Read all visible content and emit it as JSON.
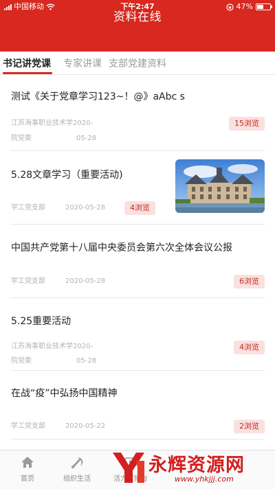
{
  "status_bar": {
    "carrier": "中国移动",
    "time": "下午2:47",
    "battery": "47%"
  },
  "header": {
    "title": "资料在线"
  },
  "tabs": [
    {
      "label": "书记讲党课",
      "active": true
    },
    {
      "label": "专家讲课",
      "active": false
    },
    {
      "label": "支部党建资料",
      "active": false
    }
  ],
  "articles": [
    {
      "title": "测试《关于党章学习123~！@》aAbc s",
      "org_line1": "江苏海事职业技术学2020-",
      "org_line2": "院党委",
      "date_line2": "05-28",
      "views": "15浏览"
    },
    {
      "title": "5.28文章学习（重要活动)",
      "org": "学工党支部",
      "date": "2020-05-28",
      "views": "4浏览",
      "has_image": true
    },
    {
      "title": "中国共产党第十八届中央委员会第六次全体会议公报",
      "org": "学工党支部",
      "date": "2020-05-28",
      "views": "6浏览"
    },
    {
      "title": "5.25重要活动",
      "org_line1": "江苏海事职业技术学2020-",
      "org_line2": "院党委",
      "date_line2": "05-28",
      "views": "4浏览"
    },
    {
      "title": "在战“疫”中弘扬中国精神",
      "org": "学工党支部",
      "date": "2020-05-22",
      "views": "2浏览"
    }
  ],
  "tabbar": [
    {
      "label": "首页",
      "icon": "home-icon"
    },
    {
      "label": "组织生活",
      "icon": "party-emblem-icon"
    },
    {
      "label": "活力直播台",
      "icon": "live-icon"
    }
  ],
  "watermark": {
    "text": "永辉资源网",
    "url": "www.yhkjjj.com"
  },
  "colors": {
    "primary": "#d8281f",
    "badge_bg": "#f9e1df",
    "badge_text": "#c42a20"
  }
}
